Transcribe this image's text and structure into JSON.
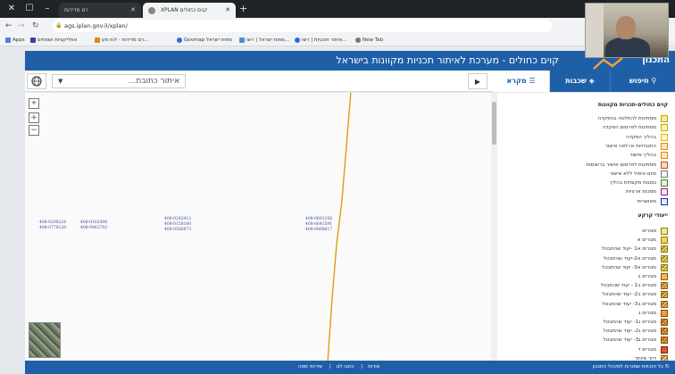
{
  "browser": {
    "tabs": [
      {
        "label": "רם מדידות",
        "active": false
      },
      {
        "label": "XPLAN קוים כחולים",
        "active": true
      }
    ],
    "address": "ags.iplan.gov.il/xplan/",
    "bookmarks": [
      "Apps",
      "אפליקציות ושמוזים",
      "רם מדידות - לוח מע...",
      "Govmap מפות ישראל",
      "מפות ישראל | רשו...",
      "איתור תוכניות | רשו...",
      "New Tab"
    ]
  },
  "app": {
    "title": "קוים כחולים - מערכת לאיתור תכניות מקוונות בישראל",
    "logo": "התכנון",
    "search_placeholder": "איתור כתובת...",
    "tabs": {
      "legend": "מקרא",
      "layers": "שכבות",
      "search": "חיפוש"
    }
  },
  "map": {
    "parcels": [
      {
        "id": "p1",
        "lines": [
          "408-0298224",
          "408-0778126"
        ]
      },
      {
        "id": "p2",
        "lines": [
          "408-0162408",
          "408-0862702"
        ]
      },
      {
        "id": "p3",
        "lines": [
          "408-0242412",
          "408-0158160",
          "408-0566873"
        ]
      },
      {
        "id": "p4",
        "lines": [
          "408-0891256",
          "408-0641591",
          "408-0868617"
        ]
      }
    ]
  },
  "legend": {
    "section1_title": "קוים כחולים-תכניות מקוונות",
    "section1_items": [
      {
        "label": "ממתינות להחלטה בהפקדה",
        "color": "#f4e9a8",
        "border": "#c9a800",
        "hatch": false
      },
      {
        "label": "ממתינות לפרסום הפקדה",
        "color": "#fbf2c2",
        "border": "#c9a800",
        "hatch": false
      },
      {
        "label": "בהליך הפקדה",
        "color": "#fff7d6",
        "border": "#e0b400",
        "hatch": false
      },
      {
        "label": "התנגדויות או לפני אישור",
        "color": "#fde2c0",
        "border": "#e08a00",
        "hatch": false
      },
      {
        "label": "בהליך אישור",
        "color": "#fde8cc",
        "border": "#e08a00",
        "hatch": false
      },
      {
        "label": "ממתינות לפרסום אישור ברשומות",
        "color": "#f7d9c6",
        "border": "#b4581d",
        "hatch": false
      },
      {
        "label": "סיום טיפול ללא אישור",
        "color": "#f3f3f3",
        "border": "#777777",
        "hatch": false
      },
      {
        "label": "נסוגות מקומיות בהליך",
        "color": "#e3f1dc",
        "border": "#3d8a2c",
        "hatch": false
      },
      {
        "label": "מסכות ארציות",
        "color": "#f3e2f3",
        "border": "#8b1e8b",
        "hatch": false
      },
      {
        "label": "מאושרות",
        "color": "#e6ebfa",
        "border": "#1b2ca8",
        "hatch": false
      }
    ],
    "section2_title": "ייעודי קרקע",
    "section2_items": [
      {
        "label": "מגורים",
        "color": "#f7e98b",
        "border": "#8a7a20",
        "hatch": false
      },
      {
        "label": "מגורים א",
        "color": "#f2d94a",
        "border": "#8a7a20",
        "hatch": false
      },
      {
        "label": "מגורים א1 -יעוד שהתבטל",
        "color": "#f2d94a",
        "border": "#8a7a20",
        "hatch": true
      },
      {
        "label": "מגורים א2-יעוד שהתבטל",
        "color": "#f2d94a",
        "border": "#8a7a20",
        "hatch": true
      },
      {
        "label": "מגורים א3- יעוד שהתבטל",
        "color": "#f2d94a",
        "border": "#8a7a20",
        "hatch": true
      },
      {
        "label": "מגורים ב",
        "color": "#f4b64e",
        "border": "#8a5a10",
        "hatch": false
      },
      {
        "label": "מגורים ב1 - יעוד שהתבטל",
        "color": "#f4b64e",
        "border": "#8a5a10",
        "hatch": true
      },
      {
        "label": "מגורים ב2- יעוד שהתבטל",
        "color": "#f4b64e",
        "border": "#8a5a10",
        "hatch": true
      },
      {
        "label": "מגורים ב3- יעוד שהתבטל",
        "color": "#f4b64e",
        "border": "#8a5a10",
        "hatch": true
      },
      {
        "label": "מגורים ג",
        "color": "#f09a34",
        "border": "#8a4a10",
        "hatch": false
      },
      {
        "label": "מגורים ג1- יעוד שהתבטל",
        "color": "#f09a34",
        "border": "#8a4a10",
        "hatch": true
      },
      {
        "label": "מגורים ג2- יעוד שהתבטל",
        "color": "#f09a34",
        "border": "#8a4a10",
        "hatch": true
      },
      {
        "label": "מגורים ג3- יעוד שהתבטל",
        "color": "#f09a34",
        "border": "#8a4a10",
        "hatch": true
      },
      {
        "label": "מגורים ד",
        "color": "#e2542b",
        "border": "#7a2010",
        "hatch": false
      },
      {
        "label": "דיור מיוחד",
        "color": "#f6c87a",
        "border": "#8a5a10",
        "hatch": true
      }
    ]
  },
  "footer": {
    "links": [
      "אודות",
      "כתבו לנו",
      "שירותי מפה"
    ],
    "copyright": "© כל הזכויות שמורות למינהל התכנון"
  },
  "colors": {
    "brand": "#1f5fa8",
    "plan_line": "#e09a10"
  }
}
